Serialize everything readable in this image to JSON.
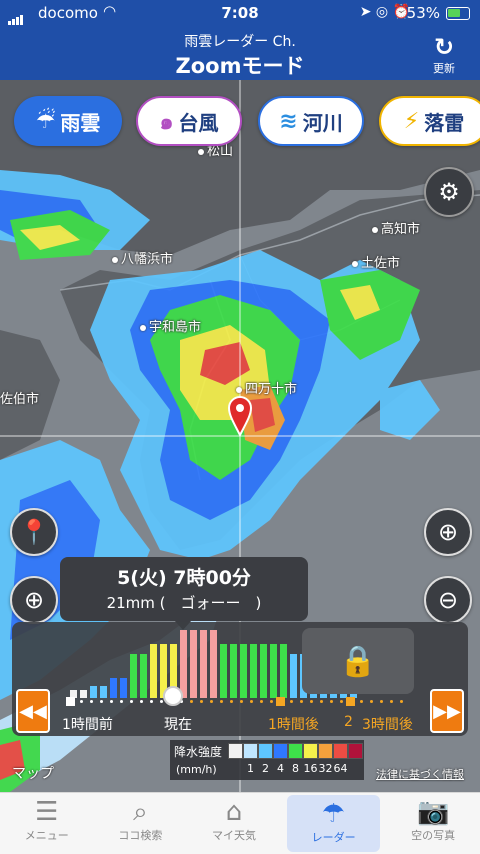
{
  "status_bar": {
    "carrier": "docomo",
    "time": "7:08",
    "battery_percent": "53%"
  },
  "header": {
    "subtitle": "雨雲レーダー Ch.",
    "title": "Zoomモード",
    "refresh_label": "更新"
  },
  "categories": [
    {
      "id": "rain",
      "label": "雨雲",
      "icon": "rain-cloud-icon",
      "active": true
    },
    {
      "id": "typhoon",
      "label": "台風",
      "icon": "typhoon-icon",
      "active": false
    },
    {
      "id": "river",
      "label": "河川",
      "icon": "river-icon",
      "active": false
    },
    {
      "id": "thunder",
      "label": "落雷",
      "icon": "lightning-icon",
      "active": false
    }
  ],
  "map": {
    "places": [
      {
        "name": "松山",
        "label": "松山"
      },
      {
        "name": "八幡浜市",
        "label": "八幡浜市"
      },
      {
        "name": "宇和島市",
        "label": "宇和島市"
      },
      {
        "name": "高知市",
        "label": "高知市"
      },
      {
        "name": "土佐市",
        "label": "土佐市"
      },
      {
        "name": "四万十市",
        "label": "四万十市"
      },
      {
        "name": "佐伯市",
        "label": "佐伯市"
      }
    ],
    "credit": "マップ"
  },
  "info_popup": {
    "datetime": "5(火) 7時00分",
    "amount": "21mm (　ゴォーー　)"
  },
  "timeline": {
    "labels": {
      "minus_1h": "1時間前",
      "now": "現在",
      "plus_1h": "1時間後",
      "plus_2": "2",
      "plus_3h": "3時間後"
    },
    "bar_levels_mm": [
      1,
      1,
      2,
      2,
      4,
      4,
      8,
      8,
      16,
      16,
      16,
      32,
      32,
      32,
      32,
      16,
      16,
      16,
      16,
      16,
      16,
      16,
      8,
      8,
      8,
      8,
      8,
      8,
      8
    ],
    "locked": true
  },
  "legend": {
    "title": "降水強度",
    "unit": "(mm/h)",
    "scale": [
      "1",
      "2",
      "4",
      "8",
      "16",
      "32",
      "64"
    ],
    "colors": [
      "#f2f2f2",
      "#bfe6ff",
      "#5ec6ff",
      "#2f78ff",
      "#3ee04a",
      "#f5f04b",
      "#f5a13c",
      "#ec4c43",
      "#b0123a"
    ]
  },
  "law_link": "法律に基づく情報",
  "bottom_nav": [
    {
      "label": "メニュー",
      "icon": "hamburger-menu-icon"
    },
    {
      "label": "ココ検索",
      "icon": "search-icon"
    },
    {
      "label": "マイ天気",
      "icon": "home-icon"
    },
    {
      "label": "レーダー",
      "icon": "umbrella-icon",
      "active": true
    },
    {
      "label": "空の写真",
      "icon": "camera-icon"
    }
  ]
}
